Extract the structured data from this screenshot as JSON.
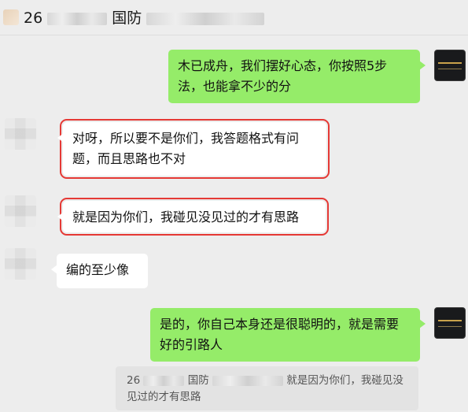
{
  "header": {
    "title_prefix": "26",
    "title_mid": "国防"
  },
  "messages": [
    {
      "side": "right",
      "text": "木已成舟，我们摆好心态，你按照5步法，也能拿不少的分"
    },
    {
      "side": "left",
      "text": "对呀，所以要不是你们，我答题格式有问题，而且思路也不对",
      "highlighted": true
    },
    {
      "side": "left",
      "text": "就是因为你们，我碰见没见过的才有思路",
      "highlighted": true
    },
    {
      "side": "left",
      "text": "编的至少像"
    },
    {
      "side": "right",
      "text": "是的，你自己本身还是很聪明的，就是需要好的引路人"
    }
  ],
  "quote": {
    "author_prefix": "26",
    "author_mid": "国防",
    "text": "就是因为你们，我碰见没见过的才有思路"
  },
  "colors": {
    "green_bubble": "#95ec69",
    "white_bubble": "#ffffff",
    "highlight_box": "#e53935",
    "background": "#ededed"
  },
  "icons": {
    "sender_avatar": "pixelated-avatar",
    "self_avatar": "dark-logo-avatar"
  }
}
